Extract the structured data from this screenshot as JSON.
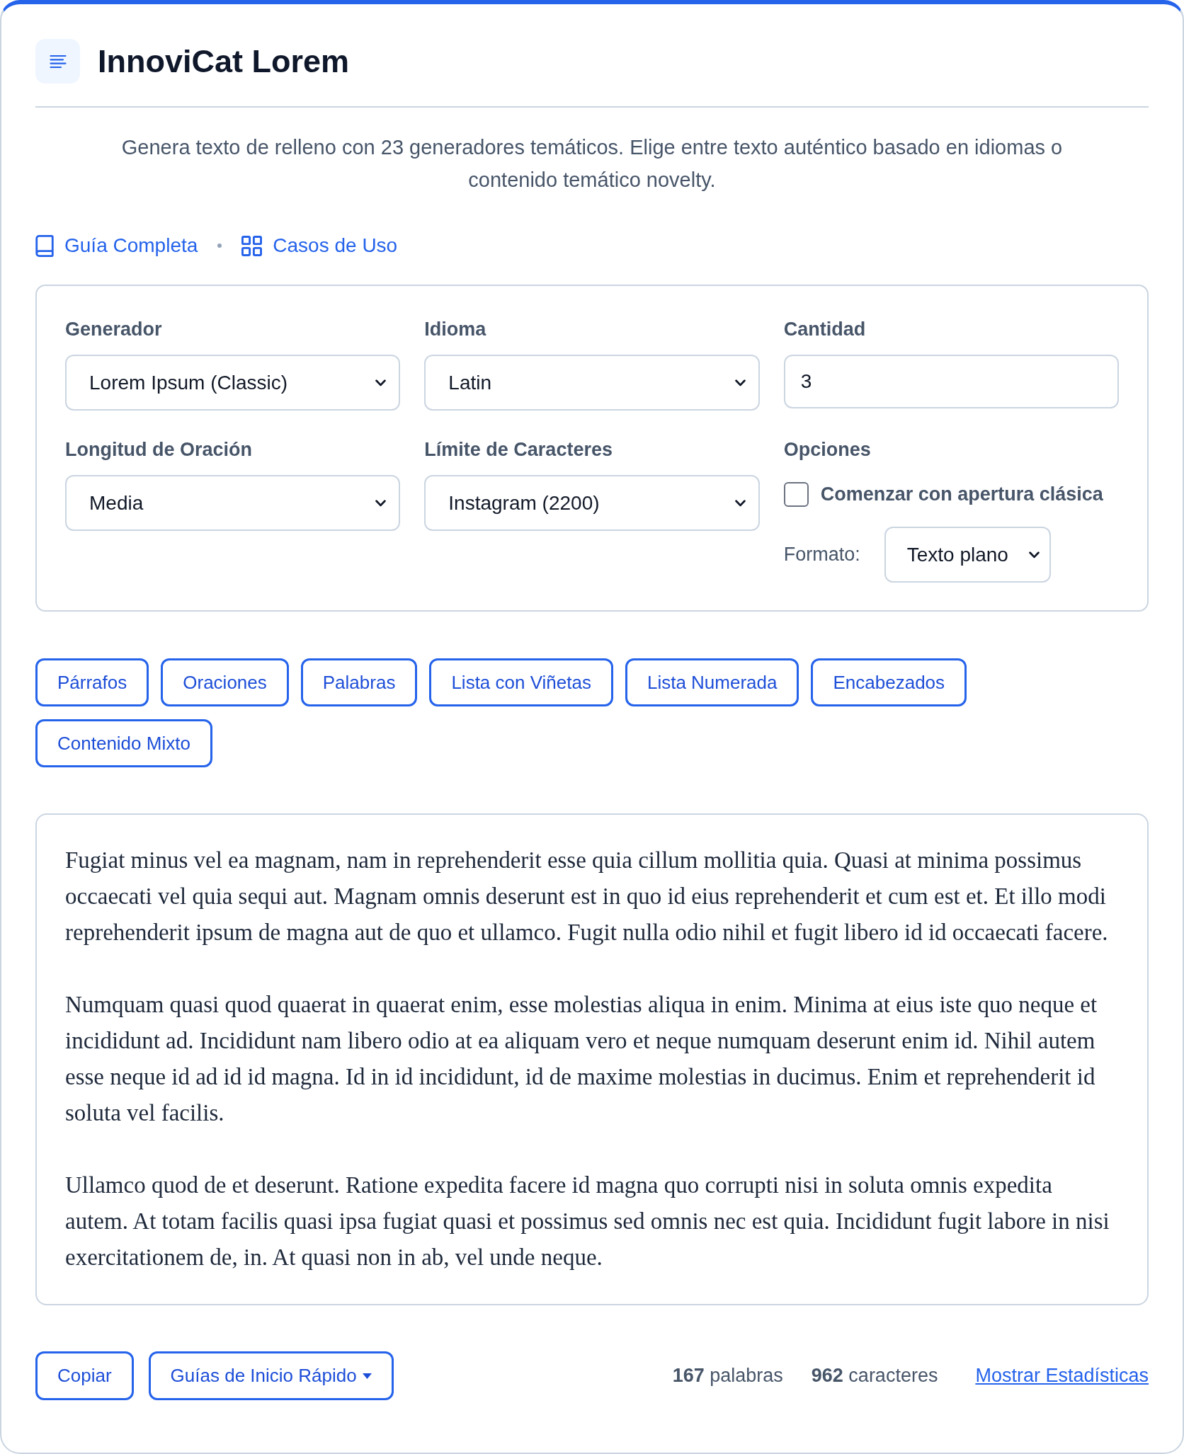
{
  "header": {
    "title": "InnoviCat Lorem",
    "description": "Genera texto de relleno con 23 generadores temáticos. Elige entre texto auténtico basado en idiomas o contenido temático novelty."
  },
  "links": [
    {
      "label": "Guía Completa",
      "kind": "guide"
    },
    {
      "label": "Casos de Uso",
      "kind": "use_cases"
    }
  ],
  "settings": {
    "fields": [
      {
        "label": "Generador",
        "kind": "select",
        "value": "Lorem Ipsum (Classic)"
      },
      {
        "label": "Idioma",
        "kind": "select",
        "value": "Latin"
      },
      {
        "label": "Cantidad",
        "kind": "number",
        "value": "3"
      },
      {
        "label": "Longitud de Oración",
        "kind": "select",
        "value": "Media"
      },
      {
        "label": "Límite de Caracteres",
        "kind": "select",
        "value": "Instagram (2200)"
      }
    ],
    "options": {
      "label": "Opciones",
      "checkbox": {
        "label": "Comenzar con apertura clásica",
        "checked": false
      },
      "format": {
        "label": "Formato:",
        "value": "Texto plano"
      }
    }
  },
  "output_modes": [
    "Párrafos",
    "Oraciones",
    "Palabras",
    "Lista con Viñetas",
    "Lista Numerada",
    "Encabezados",
    "Contenido Mixto"
  ],
  "output": {
    "paragraphs": [
      "Fugiat minus vel ea magnam, nam in reprehenderit esse quia cillum mollitia quia. Quasi at minima possimus occaecati vel quia sequi aut. Magnam omnis deserunt est in quo id eius reprehenderit et cum est et. Et illo modi reprehenderit ipsum de magna aut de quo et ullamco. Fugit nulla odio nihil et fugit libero id id occaecati facere.",
      "Numquam quasi quod quaerat in quaerat enim, esse molestias aliqua in enim. Minima at eius iste quo neque et incididunt ad. Incididunt nam libero odio at ea aliquam vero et neque numquam deserunt enim id. Nihil autem esse neque id ad id id magna. Id in id incididunt, id de maxime molestias in ducimus. Enim et reprehenderit id soluta vel facilis.",
      "Ullamco quod de et deserunt. Ratione expedita facere id magna quo corrupti nisi in soluta omnis expedita autem. At totam facilis quasi ipsa fugiat quasi et possimus sed omnis nec est quia. Incididunt fugit labore in nisi exercitationem de, in. At quasi non in ab, vel unde neque."
    ]
  },
  "footer": {
    "buttons": [
      {
        "label": "Copiar",
        "kind": "plain"
      },
      {
        "label": "Guías de Inicio Rápido",
        "kind": "dropdown"
      }
    ],
    "stats": [
      "**167** palabras",
      "**962** caracteres"
    ],
    "stats_link": "Mostrar Estadísticas"
  }
}
